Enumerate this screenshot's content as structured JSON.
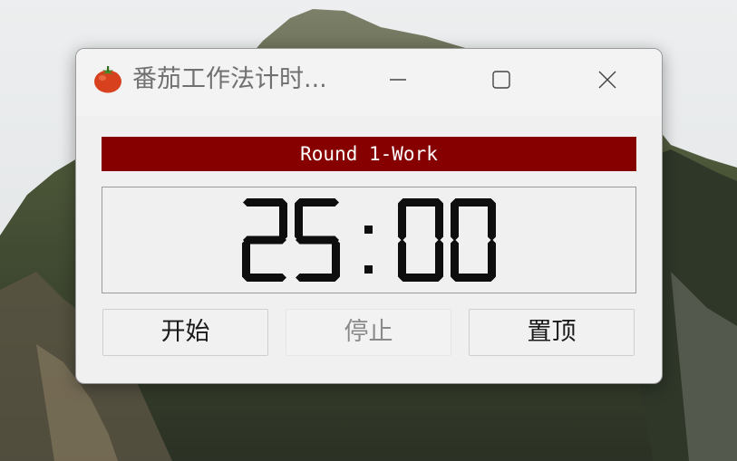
{
  "window": {
    "title": "番茄工作法计时...",
    "app_icon": "tomato-icon",
    "controls": {
      "minimize_icon": "minimize-icon",
      "maximize_icon": "maximize-icon",
      "close_icon": "close-icon"
    }
  },
  "timer": {
    "round_label": "Round 1-Work",
    "minutes": "25",
    "seconds": "00",
    "display": "25:00"
  },
  "buttons": {
    "start": "开始",
    "stop": "停止",
    "pin": "置顶"
  },
  "colors": {
    "banner_bg": "#870000",
    "banner_text": "#ffffff",
    "digit_color": "#0e0e0e",
    "disabled_text": "#8a8a8a"
  }
}
